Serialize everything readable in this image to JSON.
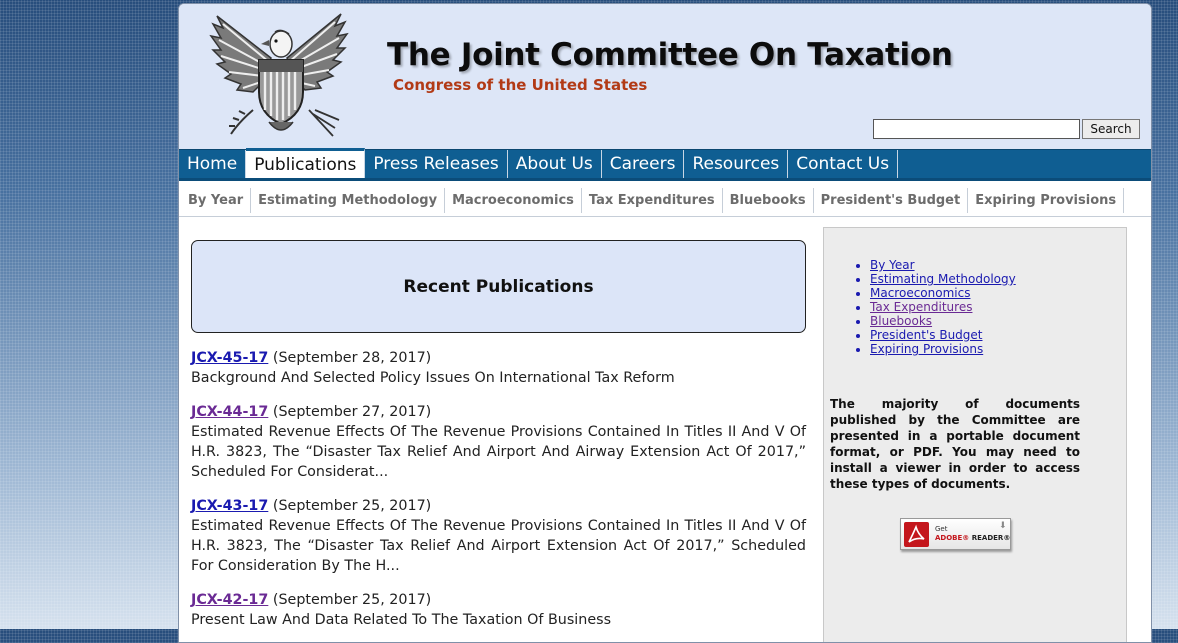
{
  "header": {
    "title": "The Joint Committee On Taxation",
    "subtitle": "Congress of the United States",
    "seal_icon": "eagle-seal-icon",
    "search": {
      "value": "",
      "placeholder": "",
      "button_label": "Search"
    }
  },
  "main_nav": {
    "items": [
      {
        "label": "Home",
        "active": false
      },
      {
        "label": "Publications",
        "active": true
      },
      {
        "label": "Press Releases",
        "active": false
      },
      {
        "label": "About Us",
        "active": false
      },
      {
        "label": "Careers",
        "active": false
      },
      {
        "label": "Resources",
        "active": false
      },
      {
        "label": "Contact Us",
        "active": false
      }
    ]
  },
  "sub_nav": {
    "items": [
      "By Year",
      "Estimating Methodology",
      "Macroeconomics",
      "Tax Expenditures",
      "Bluebooks",
      "President's Budget",
      "Expiring Provisions"
    ]
  },
  "main": {
    "section_title": "Recent Publications",
    "publications": [
      {
        "id": "JCX-45-17",
        "date": "(September 28, 2017)",
        "description": "Background And Selected Policy Issues On International Tax Reform",
        "visited": false
      },
      {
        "id": "JCX-44-17",
        "date": "(September 27, 2017)",
        "description": "Estimated Revenue Effects Of The Revenue Provisions Contained In Titles II And V Of H.R. 3823, The “Disaster Tax Relief And Airport And Airway Extension Act Of 2017,” Scheduled For Considerat...",
        "visited": true
      },
      {
        "id": "JCX-43-17",
        "date": "(September 25, 2017)",
        "description": "Estimated Revenue Effects Of The Revenue Provisions Contained In Titles II And V Of H.R. 3823, The “Disaster Tax Relief And Airport Extension Act Of 2017,” Scheduled For Consideration By The H...",
        "visited": false
      },
      {
        "id": "JCX-42-17",
        "date": "(September 25, 2017)",
        "description": "Present Law And Data Related To The Taxation Of Business",
        "visited": true
      }
    ]
  },
  "sidebar": {
    "links": [
      {
        "label": "By Year",
        "visited": false
      },
      {
        "label": "Estimating Methodology",
        "visited": false
      },
      {
        "label": "Macroeconomics",
        "visited": false
      },
      {
        "label": "Tax Expenditures",
        "visited": true
      },
      {
        "label": "Bluebooks",
        "visited": true
      },
      {
        "label": "President's Budget",
        "visited": false
      },
      {
        "label": "Expiring Provisions",
        "visited": false
      }
    ],
    "pdf_note": "The majority of documents published by the Committee are presented in a portable document format, or PDF. You may need to install a viewer in order to access these types of documents.",
    "adobe": {
      "get_label": "Get",
      "brand": "ADOBE",
      "product": "READER",
      "icon": "adobe-pdf-icon"
    }
  },
  "colors": {
    "nav_blue": "#0f5e92",
    "header_bg": "#dde6f7",
    "subtitle_red": "#b23a16",
    "link_blue": "#1a1ab0",
    "link_visited": "#6a2a94"
  }
}
